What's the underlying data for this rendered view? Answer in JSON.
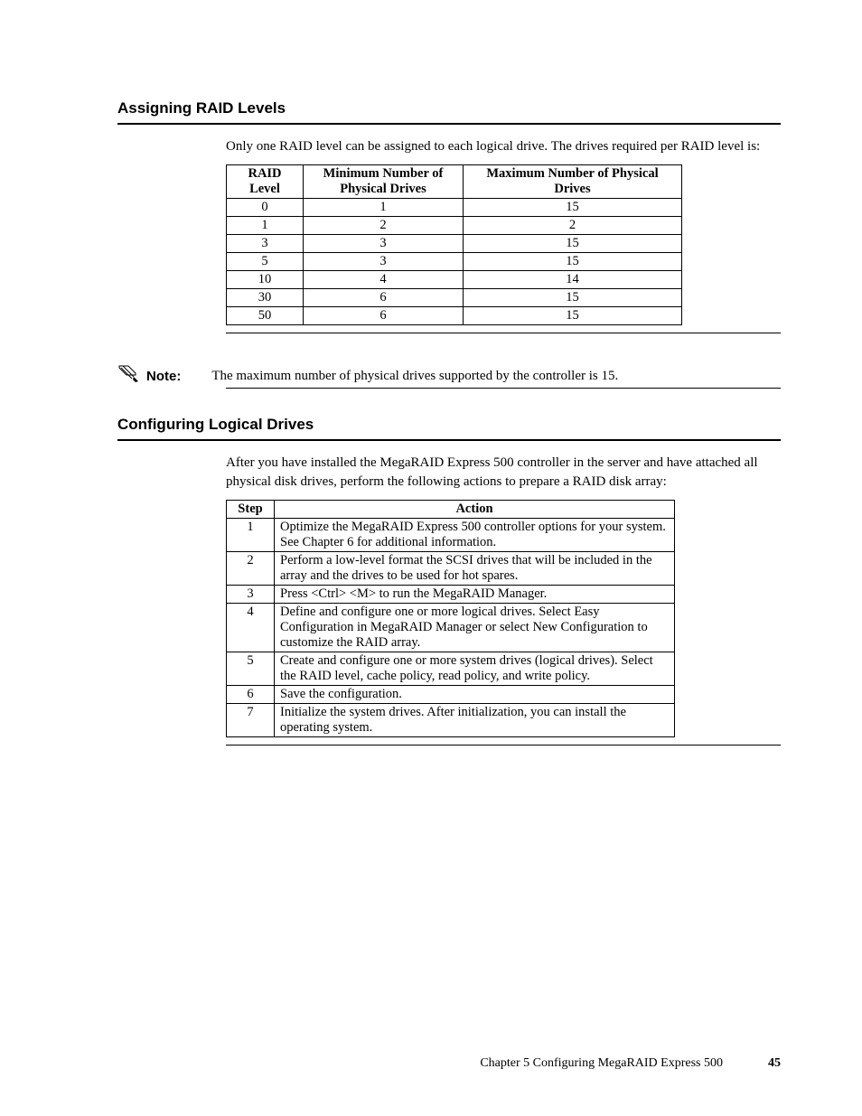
{
  "section1": {
    "heading": "Assigning RAID Levels",
    "para": "Only one RAID level can be assigned to each logical drive. The drives required per RAID level is:",
    "table": {
      "headers": [
        "RAID Level",
        "Minimum Number of Physical Drives",
        "Maximum Number of Physical Drives"
      ],
      "rows": [
        [
          "0",
          "1",
          "15"
        ],
        [
          "1",
          "2",
          "2"
        ],
        [
          "3",
          "3",
          "15"
        ],
        [
          "5",
          "3",
          "15"
        ],
        [
          "10",
          "4",
          "14"
        ],
        [
          "30",
          "6",
          "15"
        ],
        [
          "50",
          "6",
          "15"
        ]
      ]
    }
  },
  "note": {
    "label": "Note:",
    "text": "The maximum number of physical drives supported by the controller is 15."
  },
  "section2": {
    "heading": "Configuring Logical Drives",
    "para": "After you have installed the MegaRAID Express 500 controller in the server and have attached all physical disk drives, perform the following actions to prepare a RAID disk array:",
    "table": {
      "headers": [
        "Step",
        "Action"
      ],
      "rows": [
        [
          "1",
          "Optimize the MegaRAID Express 500 controller options for your system. See Chapter 6 for additional information."
        ],
        [
          "2",
          "Perform a low-level format the SCSI drives that will be included in the array and the drives to be used for hot spares."
        ],
        [
          "3",
          "Press <Ctrl> <M> to run the MegaRAID Manager."
        ],
        [
          "4",
          "Define and configure one or more logical drives. Select Easy Configuration in MegaRAID Manager or select New Configuration to customize the RAID array."
        ],
        [
          "5",
          "Create and configure one or more system drives (logical drives). Select the RAID level, cache policy, read policy, and write policy."
        ],
        [
          "6",
          "Save the configuration."
        ],
        [
          "7",
          "Initialize the system drives. After initialization, you can install the operating system."
        ]
      ]
    }
  },
  "footer": {
    "chapter": "Chapter 5 Configuring MegaRAID Express 500",
    "page": "45"
  }
}
